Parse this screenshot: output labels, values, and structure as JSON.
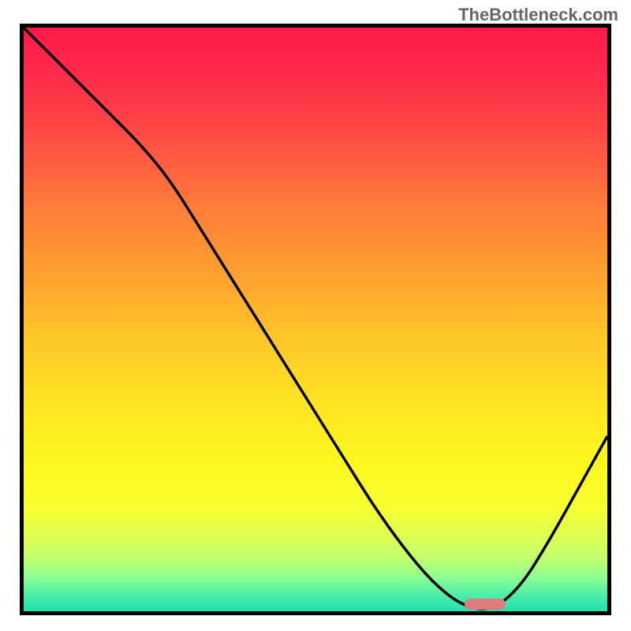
{
  "watermark": "TheBottleneck.com",
  "chart_data": {
    "type": "line",
    "title": "",
    "xlabel": "",
    "ylabel": "",
    "xlim": [
      0,
      100
    ],
    "ylim": [
      0,
      100
    ],
    "x": [
      0,
      5,
      10,
      15,
      20,
      25,
      30,
      35,
      40,
      45,
      50,
      55,
      60,
      65,
      70,
      75,
      80,
      85,
      90,
      95,
      100
    ],
    "values": [
      100,
      95,
      90,
      85,
      80,
      74,
      66,
      58,
      50,
      42,
      34,
      26,
      18,
      11,
      5,
      1,
      0,
      4,
      12,
      21,
      30
    ],
    "minimum_marker_x": 79,
    "gradient_colors": [
      "#ff1a4a",
      "#ffc928",
      "#fff81e",
      "#20e0b0"
    ]
  }
}
